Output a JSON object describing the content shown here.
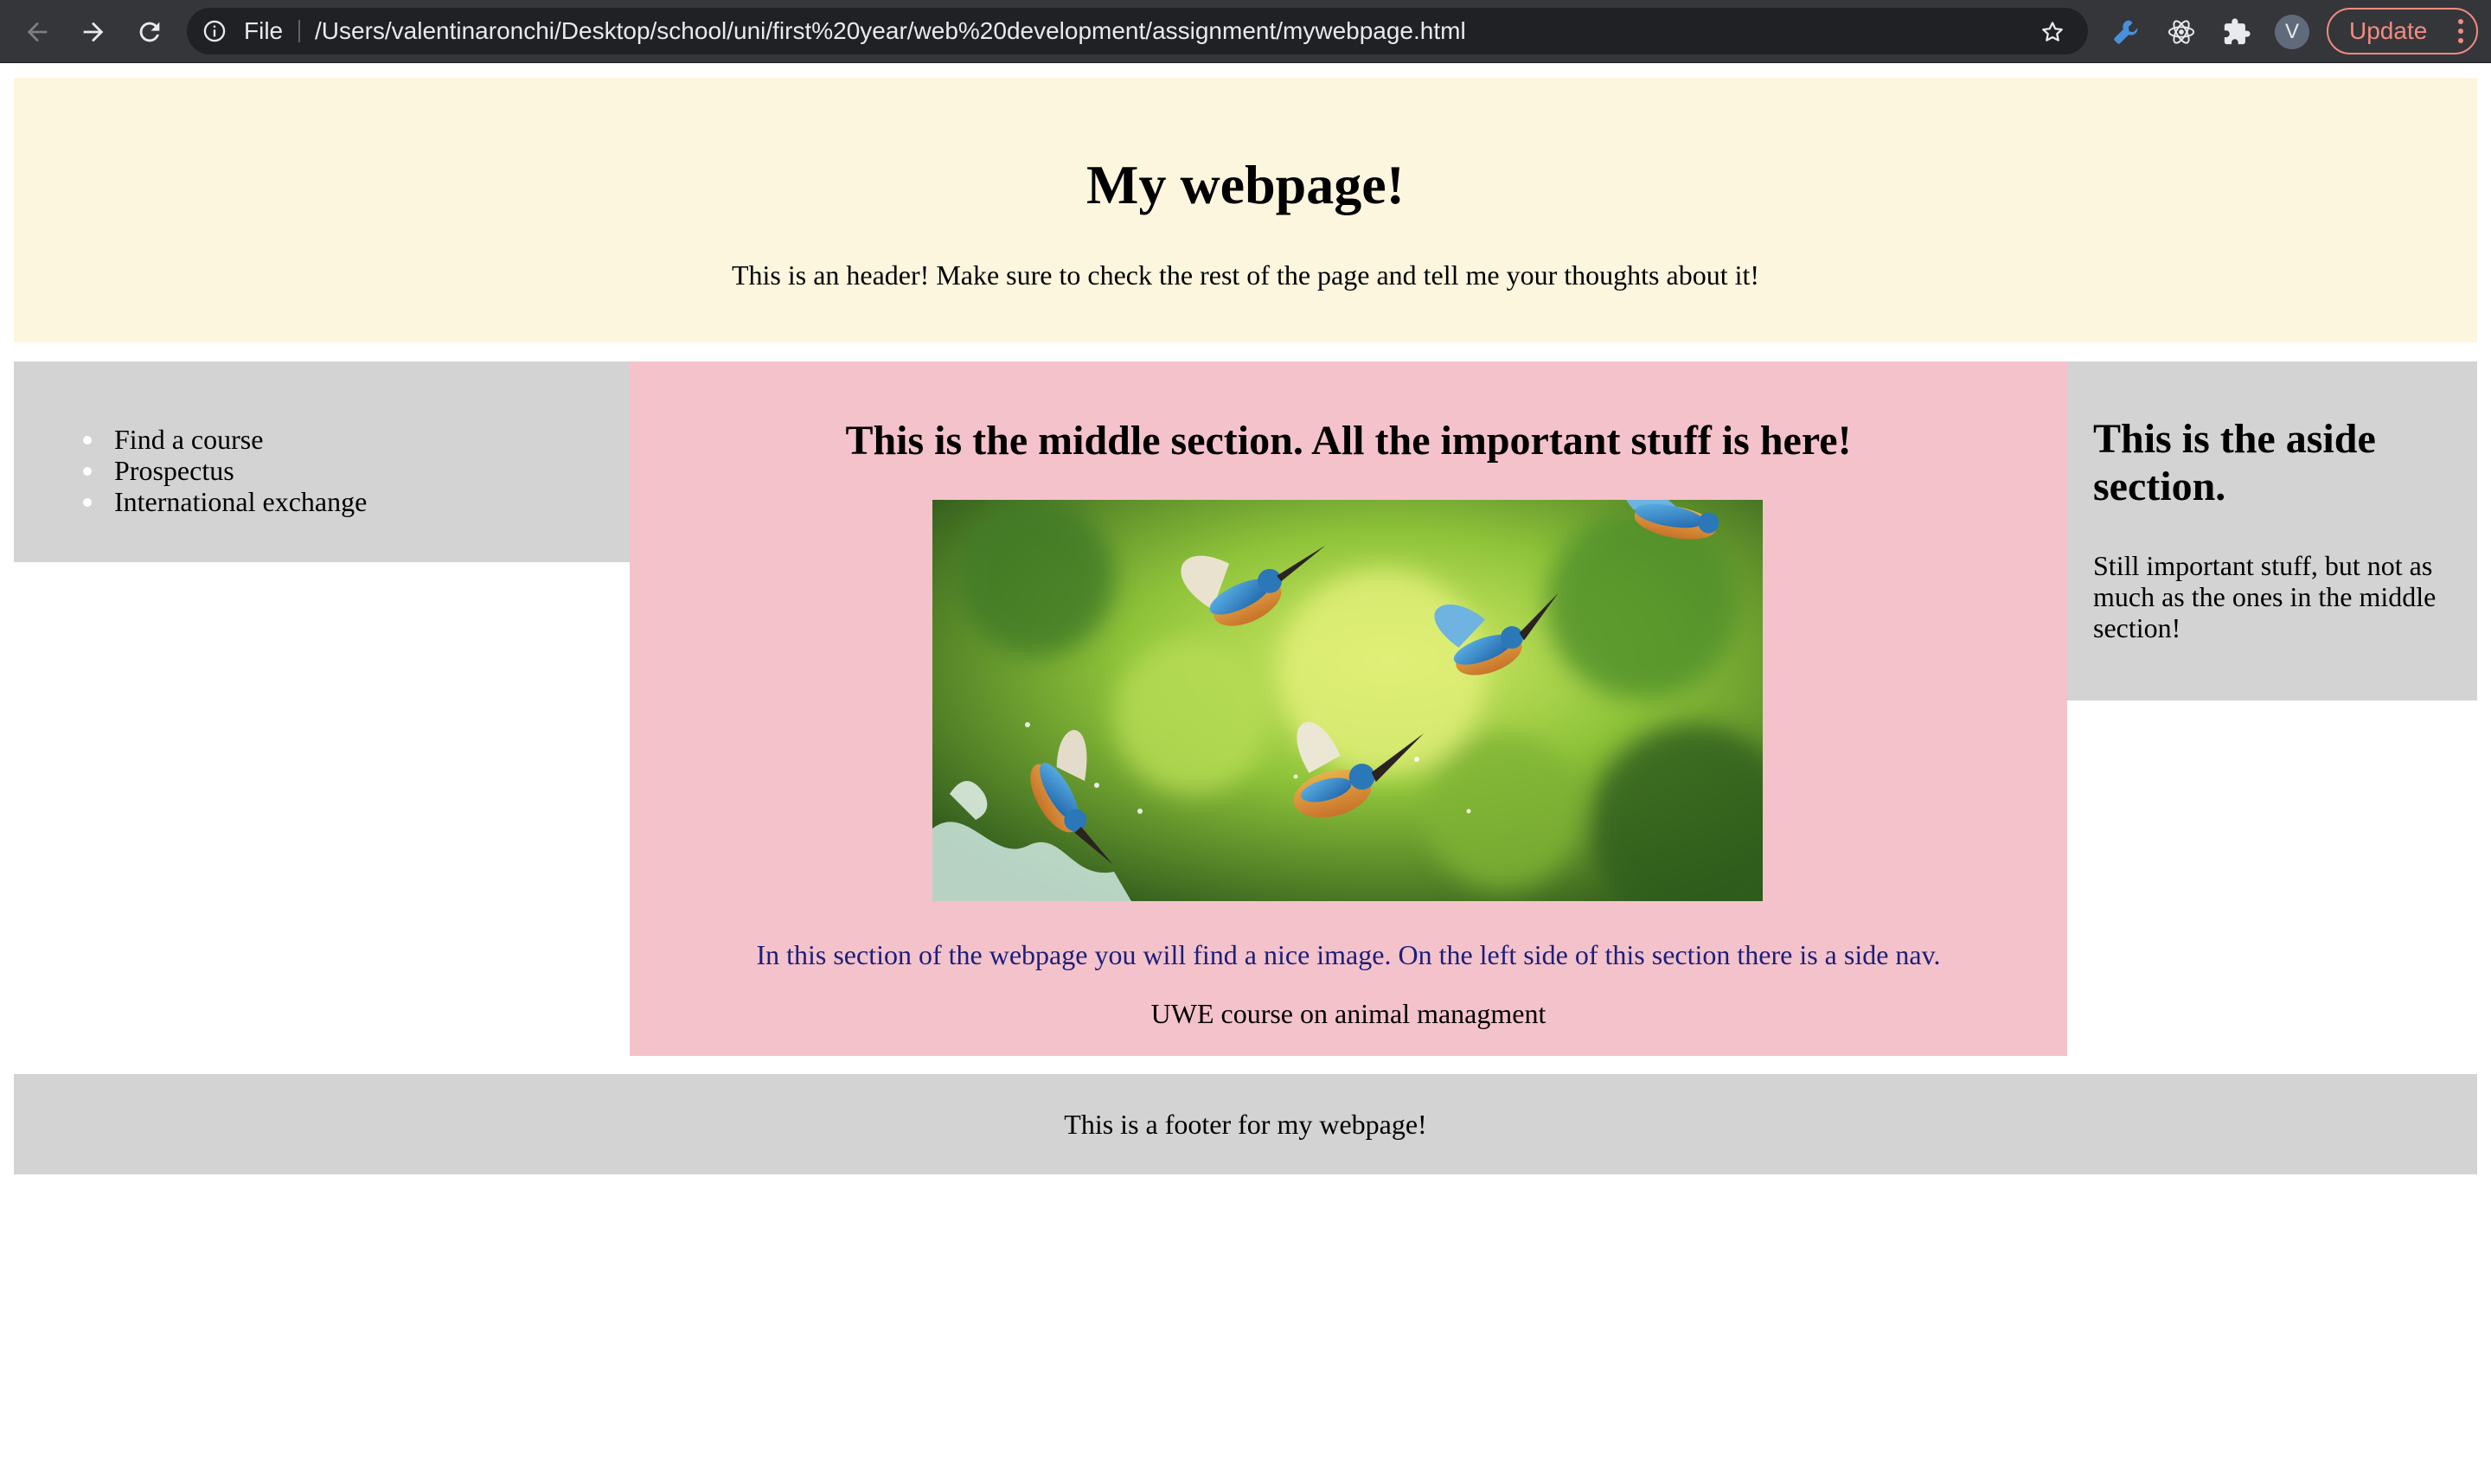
{
  "browser": {
    "address_scheme_label": "File",
    "url": "/Users/valentinaronchi/Desktop/school/uni/first%20year/web%20development/assignment/mywebpage.html",
    "profile_initial": "V",
    "update_label": "Update",
    "icons": {
      "back": "back-arrow-icon",
      "forward": "forward-arrow-icon",
      "reload": "reload-icon",
      "info": "info-icon",
      "bookmark": "star-icon",
      "extension_1": "wrench-extension-icon",
      "extension_2": "react-atom-icon",
      "extensions": "puzzle-icon",
      "menu": "kebab-menu-icon"
    }
  },
  "header": {
    "title": "My webpage!",
    "subtitle": "This is an header! Make sure to check the rest of the page and tell me your thoughts about it!"
  },
  "sidenav": {
    "items": [
      {
        "label": "Find a course"
      },
      {
        "label": "Prospectus"
      },
      {
        "label": "International exchange"
      }
    ]
  },
  "main": {
    "heading": "This is the middle section. All the important stuff is here!",
    "image_subject": "kingfishers-photo",
    "description": "In this section of the webpage you will find a nice image. On the left side of this section there is a side nav.",
    "course_link": "UWE course on animal managment"
  },
  "aside": {
    "heading": "This is the aside section.",
    "text": "Still important stuff, but not as much as the ones in the middle section!"
  },
  "footer": {
    "text": "This is a footer for my webpage!"
  },
  "colors": {
    "header_bg": "#fdf6df",
    "panel_bg": "#d3d3d3",
    "middle_bg": "#f4c2cb",
    "description_text": "#1a1f7a",
    "chrome_bg": "#35363a",
    "update_accent": "#f28b82"
  }
}
